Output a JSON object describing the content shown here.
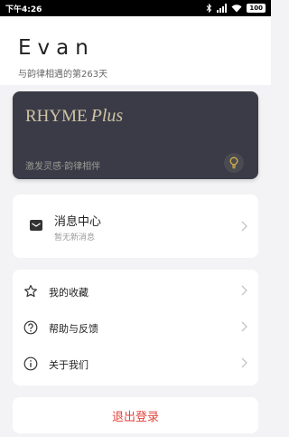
{
  "statusbar": {
    "time": "下午4:26",
    "battery": "100"
  },
  "profile": {
    "name": "Evan",
    "days_text": "与韵律相遇的第263天"
  },
  "card": {
    "brand": "RHYME",
    "brand_plus": "Plus",
    "slogan": "激发灵感·韵律相伴"
  },
  "messages": {
    "title": "消息中心",
    "subtitle": "暂无新消息"
  },
  "menu": [
    {
      "label": "我的收藏"
    },
    {
      "label": "帮助与反馈"
    },
    {
      "label": "关于我们"
    }
  ],
  "logout": {
    "label": "退出登录"
  },
  "colors": {
    "card_bg": "#3a3b47",
    "brand_gold": "#cfc3a4",
    "logout_red": "#e2443c"
  }
}
